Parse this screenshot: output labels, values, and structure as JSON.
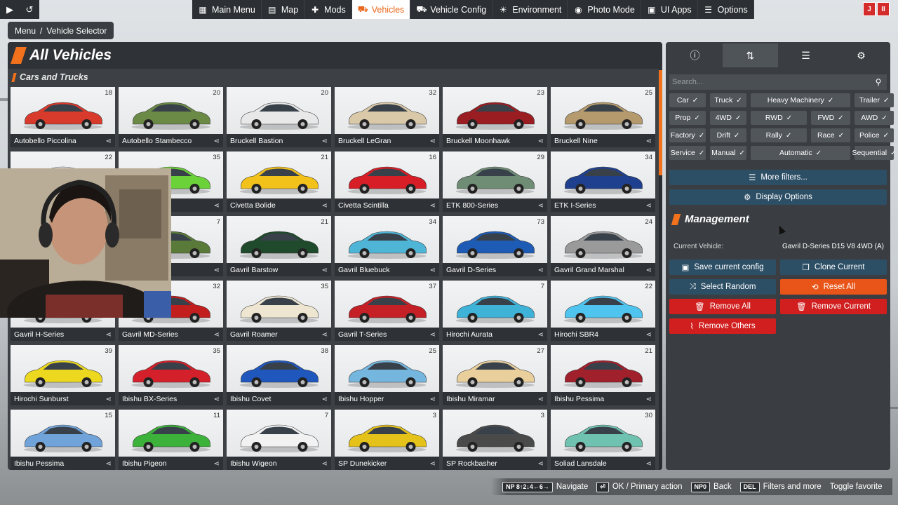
{
  "topbar": {
    "nav": [
      {
        "label": "Main Menu",
        "icon": "grid-icon",
        "glyph": "▦",
        "active": false
      },
      {
        "label": "Map",
        "icon": "map-icon",
        "glyph": "▤",
        "active": false
      },
      {
        "label": "Mods",
        "icon": "puzzle-icon",
        "glyph": "✚",
        "active": false
      },
      {
        "label": "Vehicles",
        "icon": "car-icon",
        "glyph": "⛟",
        "active": true
      },
      {
        "label": "Vehicle Config",
        "icon": "config-car-icon",
        "glyph": "⛟",
        "active": false
      },
      {
        "label": "Environment",
        "icon": "sun-icon",
        "glyph": "☀",
        "active": false
      },
      {
        "label": "Photo Mode",
        "icon": "camera-icon",
        "glyph": "◉",
        "active": false
      },
      {
        "label": "UI Apps",
        "icon": "apps-icon",
        "glyph": "▣",
        "active": false
      },
      {
        "label": "Options",
        "icon": "sliders-icon",
        "glyph": "☰",
        "active": false
      }
    ],
    "right": [
      "J",
      "II"
    ]
  },
  "breadcrumb": {
    "root": "Menu",
    "sep": "/",
    "current": "Vehicle Selector"
  },
  "main": {
    "title": "All Vehicles",
    "section": "Cars and Trucks",
    "accent": "#f2711c"
  },
  "vehicles": [
    {
      "name": "Autobello Piccolina",
      "count": "18",
      "color": "#d83a2c"
    },
    {
      "name": "Autobello Stambecco",
      "count": "20",
      "color": "#6b8a45"
    },
    {
      "name": "Bruckell Bastion",
      "count": "20",
      "color": "#e8e8e8"
    },
    {
      "name": "Bruckell LeGran",
      "count": "32",
      "color": "#d9c9a8"
    },
    {
      "name": "Bruckell Moonhawk",
      "count": "23",
      "color": "#9a1d22"
    },
    {
      "name": "Bruckell Nine",
      "count": "25",
      "color": "#b49a6c"
    },
    {
      "name": "",
      "count": "22",
      "color": "#dcdcdc"
    },
    {
      "name": "",
      "count": "35",
      "color": "#6bd23a"
    },
    {
      "name": "Civetta Bolide",
      "count": "21",
      "color": "#f2c21b"
    },
    {
      "name": "Civetta Scintilla",
      "count": "16",
      "color": "#d71e26"
    },
    {
      "name": "ETK 800-Series",
      "count": "29",
      "color": "#6f8c74"
    },
    {
      "name": "ETK I-Series",
      "count": "34",
      "color": "#1f3f8f"
    },
    {
      "name": "",
      "count": "",
      "color": "#dcdcdc"
    },
    {
      "name": "",
      "count": "7",
      "color": "#5a7a3a"
    },
    {
      "name": "Gavril Barstow",
      "count": "21",
      "color": "#1f4a2c"
    },
    {
      "name": "Gavril Bluebuck",
      "count": "34",
      "color": "#4fb5d6"
    },
    {
      "name": "Gavril D-Series",
      "count": "73",
      "color": "#1d5bb5"
    },
    {
      "name": "Gavril Grand Marshal",
      "count": "24",
      "color": "#9a9a9a"
    },
    {
      "name": "Gavril H-Series",
      "count": "",
      "color": "#c9c9c9"
    },
    {
      "name": "Gavril MD-Series",
      "count": "32",
      "color": "#c21e1e"
    },
    {
      "name": "Gavril Roamer",
      "count": "35",
      "color": "#efe6d1"
    },
    {
      "name": "Gavril T-Series",
      "count": "37",
      "color": "#c52026"
    },
    {
      "name": "Hirochi Aurata",
      "count": "7",
      "color": "#3fb2d8"
    },
    {
      "name": "Hirochi SBR4",
      "count": "22",
      "color": "#4fc4ef"
    },
    {
      "name": "Hirochi Sunburst",
      "count": "39",
      "color": "#ecd91f"
    },
    {
      "name": "Ibishu BX-Series",
      "count": "35",
      "color": "#d4202a"
    },
    {
      "name": "Ibishu Covet",
      "count": "38",
      "color": "#1f57bd"
    },
    {
      "name": "Ibishu Hopper",
      "count": "25",
      "color": "#74b6de"
    },
    {
      "name": "Ibishu Miramar",
      "count": "27",
      "color": "#e8cf9c"
    },
    {
      "name": "Ibishu Pessima",
      "count": "21",
      "color": "#a0202c"
    },
    {
      "name": "Ibishu Pessima",
      "count": "15",
      "color": "#6fa3d9"
    },
    {
      "name": "Ibishu Pigeon",
      "count": "11",
      "color": "#3db23a"
    },
    {
      "name": "Ibishu Wigeon",
      "count": "7",
      "color": "#f2f2f2"
    },
    {
      "name": "SP Dunekicker",
      "count": "3",
      "color": "#e5c21a"
    },
    {
      "name": "SP Rockbasher",
      "count": "3",
      "color": "#4a4a4a"
    },
    {
      "name": "Soliad Lansdale",
      "count": "30",
      "color": "#6fc1b0"
    }
  ],
  "sidebar": {
    "tabs": [
      {
        "name": "info-icon",
        "glyph": "ⓘ"
      },
      {
        "name": "sort-icon",
        "glyph": "⇅"
      },
      {
        "name": "filter-icon",
        "glyph": "☰"
      },
      {
        "name": "sliders-icon",
        "glyph": "⚙"
      }
    ],
    "search_placeholder": "Search...",
    "filters": [
      {
        "label": "Car",
        "state": "✓"
      },
      {
        "label": "Truck",
        "state": "✓"
      },
      {
        "label": "Heavy Machinery",
        "state": "✓"
      },
      {
        "label": "Trailer",
        "state": "✓"
      },
      {
        "label": "Prop",
        "state": "✓"
      },
      {
        "label": "4WD",
        "state": "✓"
      },
      {
        "label": "RWD",
        "state": "✓"
      },
      {
        "label": "AWD",
        "state": "✓"
      },
      {
        "label": "Factory",
        "state": "✓"
      },
      {
        "label": "Drift",
        "state": "✓"
      },
      {
        "label": "Rally",
        "state": "✓"
      },
      {
        "label": "Police",
        "state": "✓"
      },
      {
        "label": "Service",
        "state": "✓"
      },
      {
        "label": "Manual",
        "state": "✓"
      },
      {
        "label": "Automatic",
        "state": "✓"
      },
      {
        "label": "Sequential",
        "state": "✓"
      }
    ],
    "extra_filter_row2": {
      "label": "FWD",
      "state": "✓"
    },
    "extra_filter_row3": {
      "label": "Race",
      "state": "✓"
    },
    "more_filters": "More filters...",
    "display_options": "Display Options",
    "management_title": "Management",
    "current_vehicle_label": "Current Vehicle:",
    "current_vehicle_value": "Gavril D-Series D15 V8 4WD (A)",
    "buttons": {
      "save": "Save current config",
      "clone": "Clone Current",
      "random": "Select Random",
      "reset": "Reset All",
      "remove_all": "Remove All",
      "remove_current": "Remove Current",
      "remove_others": "Remove Others"
    }
  },
  "bottom": {
    "np_keys": "NP 8↑2↓4←6→",
    "navigate": "Navigate",
    "ok_key": "⏎",
    "ok": "OK / Primary action",
    "np0": "NP0",
    "back": "Back",
    "del": "DEL",
    "filters": "Filters and more",
    "toggle": "Toggle favorite"
  }
}
